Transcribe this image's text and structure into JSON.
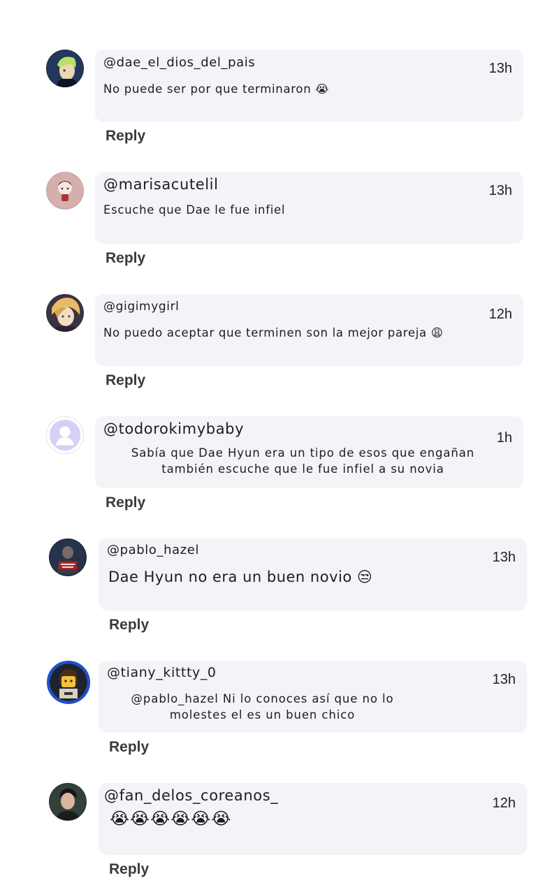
{
  "comments": [
    {
      "username": "@dae_el_dios_del_pais",
      "time": "13h",
      "text": "No puede ser por que terminaron 😭",
      "reply_label": "Reply",
      "avatar_icon": "green-haired-character-avatar-icon"
    },
    {
      "username": "@marisacutelil",
      "time": "13h",
      "text": "Escuche que Dae le fue infiel",
      "reply_label": "Reply",
      "avatar_icon": "cartoon-girl-pink-avatar-icon"
    },
    {
      "username": "@gigimygirl",
      "time": "12h",
      "text": "No puedo aceptar que terminen son la mejor pareja 😩",
      "reply_label": "Reply",
      "avatar_icon": "anime-blonde-character-avatar-icon"
    },
    {
      "username": "@todorokimybaby",
      "time": "1h",
      "text": "Sabía que Dae Hyun era un tipo de esos que engañan también escuche que le fue infiel a su novia",
      "reply_label": "Reply",
      "avatar_icon": "default-user-avatar-icon"
    },
    {
      "username": "@pablo_hazel",
      "time": "13h",
      "text": "Dae Hyun no era un buen novio 😒",
      "reply_label": "Reply",
      "avatar_icon": "dark-game-poster-avatar-icon"
    },
    {
      "username": "@tiany_kittty_0",
      "time": "13h",
      "text": "@pablo_hazel Ni lo conoces así que no lo molestes el es un buen chico",
      "reply_label": "Reply",
      "avatar_icon": "lego-figure-blue-ring-avatar-icon"
    },
    {
      "username": "@fan_delos_coreanos_",
      "time": "12h",
      "text": "😭😭😭😭😭😭",
      "reply_label": "Reply",
      "avatar_icon": "person-photo-avatar-icon"
    }
  ]
}
